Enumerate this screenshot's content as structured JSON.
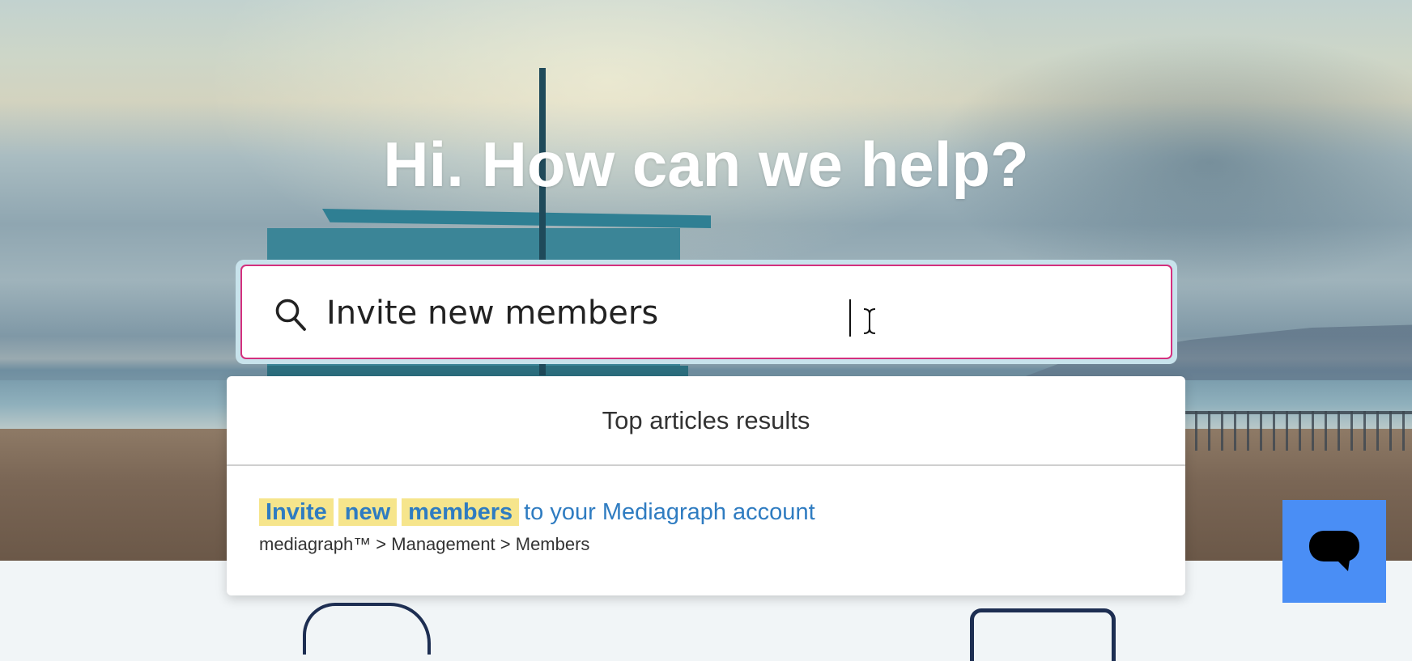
{
  "hero": {
    "title": "Hi. How can we help?"
  },
  "search": {
    "value": "Invite new members",
    "placeholder": "",
    "icon": "search-icon",
    "focus_border_color": "#d4307e"
  },
  "results": {
    "header": "Top articles results",
    "items": [
      {
        "highlighted_words": [
          "Invite",
          "new",
          "members"
        ],
        "title_rest": "to your Mediagraph account",
        "breadcrumb": "mediagraph™ > Management > Members"
      }
    ]
  },
  "chat": {
    "icon": "chat-bubble-icon",
    "color": "#4a8ef5"
  },
  "colors": {
    "link": "#2f7cc1",
    "highlight": "#f6e58c"
  }
}
